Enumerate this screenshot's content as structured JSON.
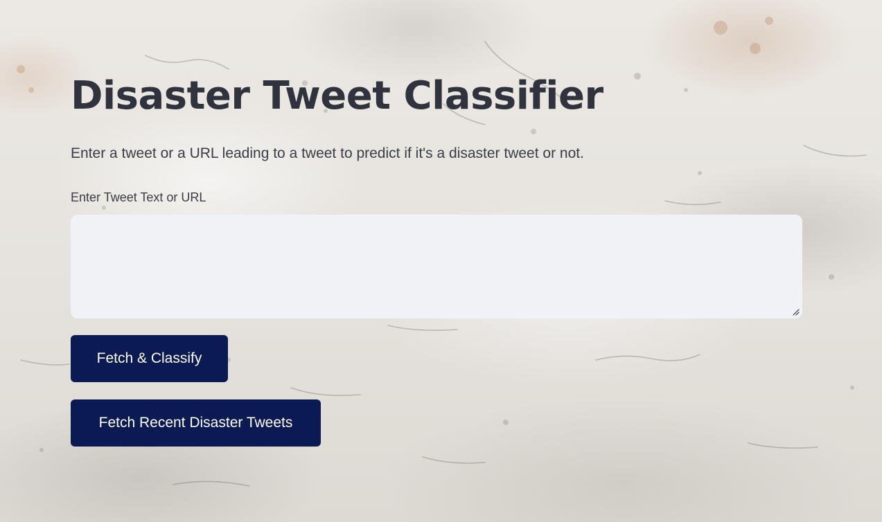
{
  "app": {
    "title": "Disaster Tweet Classifier",
    "subtitle": "Enter a tweet or a URL leading to a tweet to predict if it's a disaster tweet or not."
  },
  "input": {
    "label": "Enter Tweet Text or URL",
    "value": "",
    "placeholder": ""
  },
  "buttons": {
    "classify_label": "Fetch & Classify",
    "recent_label": "Fetch Recent Disaster Tweets"
  },
  "colors": {
    "button_bg": "#0b1a52",
    "text_dark": "#30323d",
    "input_bg": "#f1f2f6"
  },
  "icons": {
    "textarea_resize": "resize-grip-icon"
  }
}
